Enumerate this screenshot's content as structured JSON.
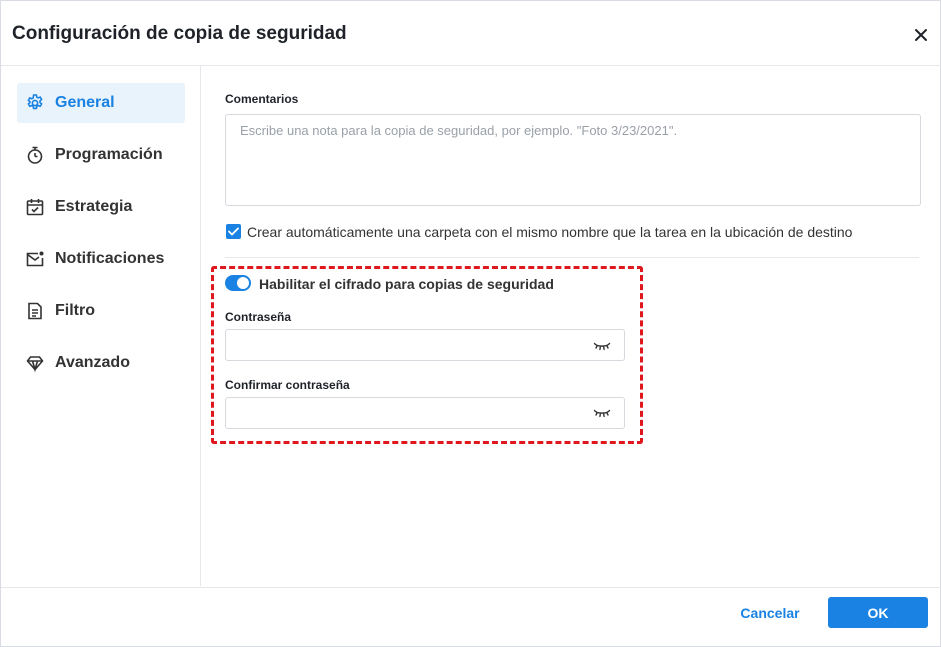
{
  "dialog": {
    "title": "Configuración de copia de seguridad",
    "close_icon": "close-icon"
  },
  "sidebar": {
    "items": [
      {
        "label": "General",
        "icon": "gear-icon",
        "active": true
      },
      {
        "label": "Programación",
        "icon": "stopwatch-icon",
        "active": false
      },
      {
        "label": "Estrategia",
        "icon": "calendar-check-icon",
        "active": false
      },
      {
        "label": "Notificaciones",
        "icon": "mail-notification-icon",
        "active": false
      },
      {
        "label": "Filtro",
        "icon": "document-filter-icon",
        "active": false
      },
      {
        "label": "Avanzado",
        "icon": "diamond-icon",
        "active": false
      }
    ]
  },
  "general": {
    "comments_label": "Comentarios",
    "comments_placeholder": "Escribe una nota para la copia de seguridad, por ejemplo. \"Foto 3/23/2021\".",
    "comments_value": "",
    "auto_folder_checked": true,
    "auto_folder_label": "Crear automáticamente una carpeta con el mismo nombre que la tarea en la ubicación de destino",
    "encryption_enabled": true,
    "encryption_label": "Habilitar el cifrado para copias de seguridad",
    "password_label": "Contraseña",
    "password_value": "",
    "confirm_password_label": "Confirmar contraseña",
    "confirm_password_value": ""
  },
  "footer": {
    "cancel_label": "Cancelar",
    "ok_label": "OK"
  },
  "colors": {
    "accent": "#1a82e2",
    "highlight_border": "#e0181e",
    "active_nav_bg": "#e9f3fc"
  }
}
